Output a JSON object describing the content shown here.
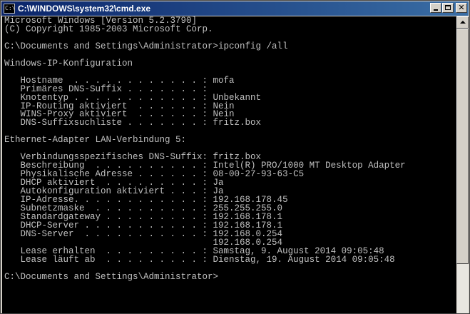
{
  "window": {
    "title": "C:\\WINDOWS\\system32\\cmd.exe",
    "icon": "cmd-icon",
    "buttons": {
      "minimize": "minimize-icon",
      "maximize": "maximize-icon",
      "close": "close-icon"
    }
  },
  "console": {
    "lines": [
      "Microsoft Windows [Version 5.2.3790]",
      "(C) Copyright 1985-2003 Microsoft Corp.",
      "",
      "C:\\Documents and Settings\\Administrator>ipconfig /all",
      "",
      "Windows-IP-Konfiguration",
      "",
      "   Hostname  . . . . . . . . . . . . : mofa",
      "   Primäres DNS-Suffix . . . . . . . :",
      "   Knotentyp . . . . . . . . . . . . : Unbekannt",
      "   IP-Routing aktiviert  . . . . . . : Nein",
      "   WINS-Proxy aktiviert  . . . . . . : Nein",
      "   DNS-Suffixsuchliste . . . . . . . : fritz.box",
      "",
      "Ethernet-Adapter LAN-Verbindung 5:",
      "",
      "   Verbindungsspezifisches DNS-Suffix: fritz.box",
      "   Beschreibung  . . . . . . . . . . : Intel(R) PRO/1000 MT Desktop Adapter",
      "   Physikalische Adresse . . . . . . : 08-00-27-93-63-C5",
      "   DHCP aktiviert  . . . . . . . . . : Ja",
      "   Autokonfiguration aktiviert . . . : Ja",
      "   IP-Adresse. . . . . . . . . . . . : 192.168.178.45",
      "   Subnetzmaske  . . . . . . . . . . : 255.255.255.0",
      "   Standardgateway . . . . . . . . . : 192.168.178.1",
      "   DHCP-Server . . . . . . . . . . . : 192.168.178.1",
      "   DNS-Server  . . . . . . . . . . . : 192.168.0.254",
      "                                       192.168.0.254",
      "   Lease erhalten  . . . . . . . . . : Samstag, 9. August 2014 09:05:48",
      "   Lease läuft ab  . . . . . . . . . : Dienstag, 19. August 2014 09:05:48",
      "",
      "C:\\Documents and Settings\\Administrator>"
    ],
    "colors": {
      "background": "#000000",
      "text": "#c0c0c0"
    }
  },
  "scrollbar": {
    "up_icon": "scroll-up-arrow-icon"
  }
}
